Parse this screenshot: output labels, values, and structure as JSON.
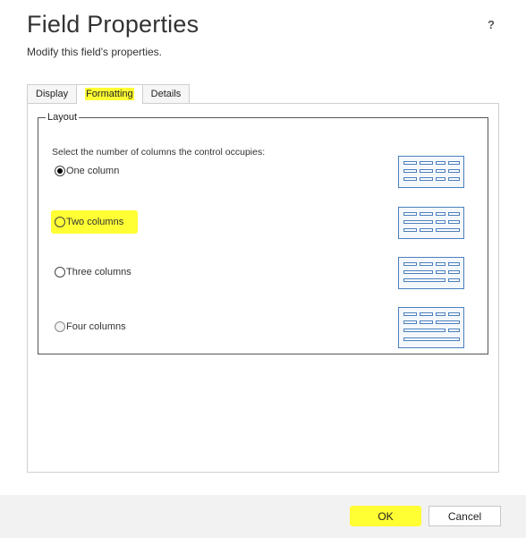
{
  "dialog": {
    "title": "Field Properties",
    "subtitle": "Modify this field's properties.",
    "help_label": "?"
  },
  "tabs": [
    {
      "label": "Display",
      "active": false
    },
    {
      "label": "Formatting",
      "active": true
    },
    {
      "label": "Details",
      "active": false
    }
  ],
  "layout": {
    "legend": "Layout",
    "instruction": "Select the number of columns the control occupies:",
    "options": [
      {
        "label": "One column",
        "checked": true,
        "preview_icon": "one-column-layout-icon"
      },
      {
        "label": "Two columns",
        "checked": false,
        "preview_icon": "two-columns-layout-icon"
      },
      {
        "label": "Three columns",
        "checked": false,
        "preview_icon": "three-columns-layout-icon"
      },
      {
        "label": "Four columns",
        "checked": false,
        "preview_icon": "four-columns-layout-icon"
      }
    ]
  },
  "footer": {
    "ok_label": "OK",
    "cancel_label": "Cancel"
  },
  "colors": {
    "highlight": "#ffff33",
    "icon_stroke": "#4a7fbd",
    "footer_bg": "#f2f2f2"
  }
}
